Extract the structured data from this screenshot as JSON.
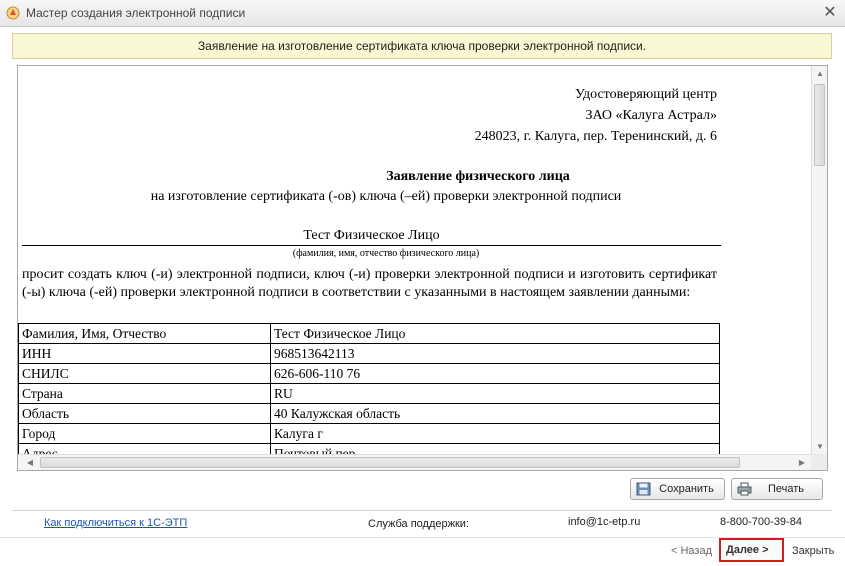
{
  "window": {
    "title": "Мастер создания электронной подписи",
    "close_glyph": "✕",
    "icon": "app-icon"
  },
  "banner": {
    "text": "Заявление на изготовление сертификата ключа проверки электронной подписи."
  },
  "document": {
    "address_lines": [
      "Удостоверяющий центр",
      "ЗАО «Калуга Астрал»",
      "248023, г. Калуга, пер. Теренинский, д. 6"
    ],
    "heading": "Заявление физического лица",
    "subheading": "на изготовление сертификата (-ов) ключа (–ей) проверки электронной подписи",
    "applicant_name": "Тест Физическое Лицо",
    "applicant_caption": "(фамилия, имя, отчество физического лица)",
    "request_text": "просит создать ключ (-и) электронной подписи, ключ (-и) проверки электронной подписи и изготовить сертификат (-ы) ключа (-ей) проверки электронной подписи в соответствии с указанными в настоящем заявлении данными:",
    "rows": [
      {
        "label": "Фамилия, Имя, Отчество",
        "value": "Тест Физическое Лицо"
      },
      {
        "label": "ИНН",
        "value": "968513642113"
      },
      {
        "label": "СНИЛС",
        "value": "626-606-110 76"
      },
      {
        "label": "Страна",
        "value": "RU"
      },
      {
        "label": "Область",
        "value": "40 Калужская область"
      },
      {
        "label": "Город",
        "value": "Калуга г"
      },
      {
        "label": "Адрес",
        "value": "Почтовый пер"
      }
    ]
  },
  "actions": {
    "save_label": "Сохранить",
    "print_label": "Печать",
    "save_icon": "save-icon",
    "print_icon": "print-icon"
  },
  "footer": {
    "link_text": "Как подключиться к 1С-ЭТП",
    "support_label": "Служба поддержки:",
    "support_email": "info@1c-etp.ru",
    "support_phone": "8-800-700-39-84"
  },
  "navigation": {
    "back_label": "< Назад",
    "next_label": "Далее  >",
    "close_label": "Закрыть"
  }
}
